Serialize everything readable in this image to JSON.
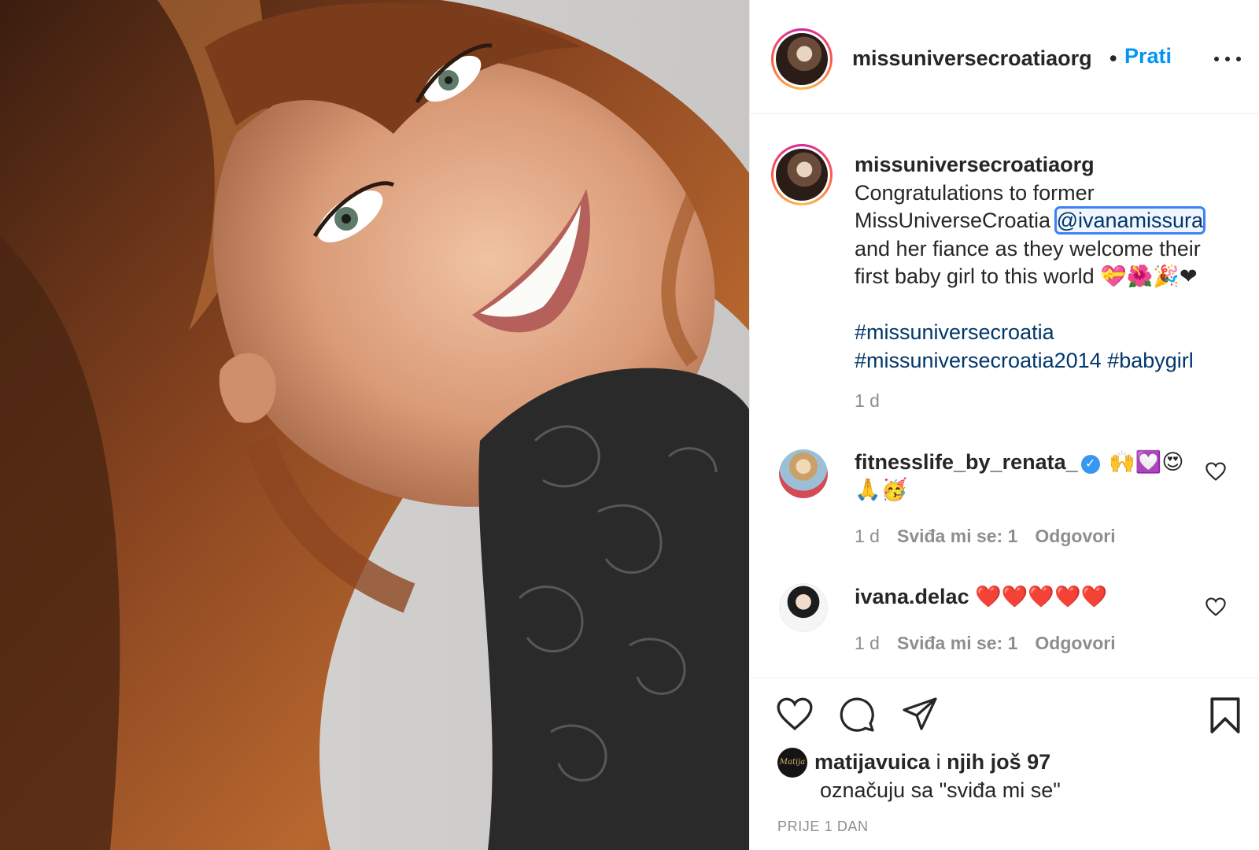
{
  "post": {
    "username": "missuniversecroatiaorg",
    "dot": "•",
    "follow_label": "Prati",
    "more_icon": "more-options-icon"
  },
  "caption": {
    "username": "missuniversecroatiaorg",
    "line1": "Congratulations to former",
    "line2_prefix": "MissUniverseCroatia ",
    "mention": "@ivanamissura",
    "line3": "and her fiance as they welcome their",
    "line4": "first baby girl to this world 💝🌺🎉❤",
    "hashtag1": "#missuniversecroatia",
    "hashtag2": "#missuniversecroatia2014",
    "hashtag3": "#babygirl",
    "time": "1 d"
  },
  "comments": [
    {
      "username": "fitnesslife_by_renata_",
      "verified_icon": "✓",
      "text_line1": "🙌💟😍",
      "text_line2": "🙏🥳",
      "time": "1 d",
      "likes": "Sviđa mi se: 1",
      "reply": "Odgovori"
    },
    {
      "username": "ivana.delac",
      "text_line1": "❤️❤️❤️❤️❤️",
      "time": "1 d",
      "likes": "Sviđa mi se: 1",
      "reply": "Odgovori"
    }
  ],
  "likes": {
    "avatar_text": "Matija",
    "first_user": "matijavuica",
    "joiner": " i ",
    "others": "njih još 97",
    "suffix": "označuju sa \"sviđa mi se\""
  },
  "date_label": "PRIJE 1 DAN",
  "colors": {
    "follow_blue": "#0095f6",
    "link_navy": "#00376b",
    "muted_gray": "#8e8e8e",
    "mention_outline": "#3b82f6"
  }
}
